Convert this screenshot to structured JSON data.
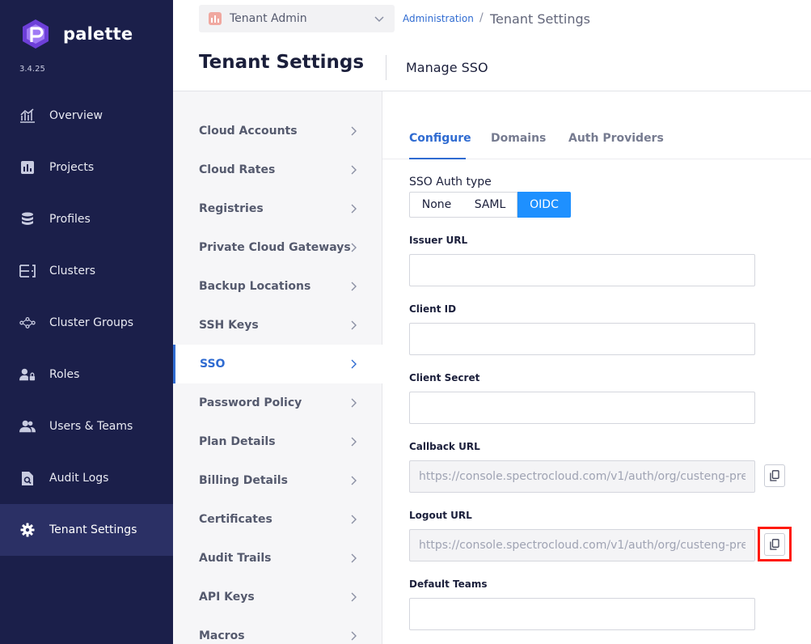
{
  "app": {
    "brand": "palette",
    "version": "3.4.25"
  },
  "colors": {
    "nav_bg": "#1b1f4a",
    "accent": "#2f6bd1",
    "selected_segment": "#1e90ff",
    "highlight": "#ff1a0a"
  },
  "nav": {
    "items": [
      {
        "label": "Overview",
        "icon": "chart-icon"
      },
      {
        "label": "Projects",
        "icon": "bar-chart-icon"
      },
      {
        "label": "Profiles",
        "icon": "database-icon"
      },
      {
        "label": "Clusters",
        "icon": "server-icon"
      },
      {
        "label": "Cluster Groups",
        "icon": "network-icon"
      },
      {
        "label": "Roles",
        "icon": "user-lock-icon"
      },
      {
        "label": "Users & Teams",
        "icon": "users-icon"
      },
      {
        "label": "Audit Logs",
        "icon": "file-search-icon"
      },
      {
        "label": "Tenant Settings",
        "icon": "gear-icon",
        "active": true
      }
    ]
  },
  "topbar": {
    "tenant": "Tenant Admin",
    "breadcrumb_link": "Administration",
    "breadcrumb_sep": "/",
    "breadcrumb_current": "Tenant Settings"
  },
  "header": {
    "title": "Tenant Settings",
    "subtitle": "Manage SSO"
  },
  "menu": {
    "items": [
      {
        "label": "Cloud Accounts"
      },
      {
        "label": "Cloud Rates"
      },
      {
        "label": "Registries"
      },
      {
        "label": "Private Cloud Gateways"
      },
      {
        "label": "Backup Locations"
      },
      {
        "label": "SSH Keys"
      },
      {
        "label": "SSO",
        "active": true
      },
      {
        "label": "Password Policy"
      },
      {
        "label": "Plan Details"
      },
      {
        "label": "Billing Details"
      },
      {
        "label": "Certificates"
      },
      {
        "label": "Audit Trails"
      },
      {
        "label": "API Keys"
      },
      {
        "label": "Macros"
      }
    ]
  },
  "tabs": [
    {
      "label": "Configure",
      "active": true
    },
    {
      "label": "Domains"
    },
    {
      "label": "Auth Providers"
    }
  ],
  "sso": {
    "auth_type_label": "SSO Auth type",
    "options": [
      "None",
      "SAML",
      "OIDC"
    ],
    "selected": "OIDC"
  },
  "form": {
    "issuer_url": {
      "label": "Issuer URL",
      "value": ""
    },
    "client_id": {
      "label": "Client ID",
      "value": ""
    },
    "client_secret": {
      "label": "Client Secret",
      "value": ""
    },
    "callback_url": {
      "label": "Callback URL",
      "value": "https://console.spectrocloud.com/v1/auth/org/custeng-pre"
    },
    "logout_url": {
      "label": "Logout URL",
      "value": "https://console.spectrocloud.com/v1/auth/org/custeng-pre"
    },
    "default_teams": {
      "label": "Default Teams",
      "value": ""
    }
  }
}
